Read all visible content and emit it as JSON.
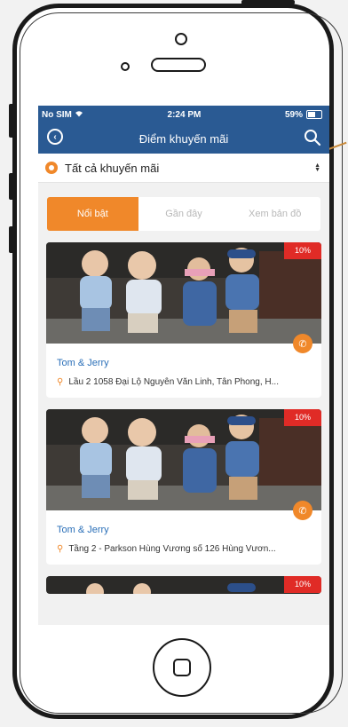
{
  "status_bar": {
    "carrier": "No SIM",
    "time": "2:24 PM",
    "battery": "59%"
  },
  "nav": {
    "title": "Điểm khuyến mãi"
  },
  "filter": {
    "label": "Tất cả khuyến mãi"
  },
  "tabs": [
    {
      "label": "Nổi bật",
      "active": true
    },
    {
      "label": "Gần đây",
      "active": false
    },
    {
      "label": "Xem bản đồ",
      "active": false
    }
  ],
  "promotions": [
    {
      "discount": "10%",
      "shop_name": "Tom & Jerry",
      "address": "Lầu 2 1058 Đại Lộ Nguyễn Văn Linh, Tân Phong, H..."
    },
    {
      "discount": "10%",
      "shop_name": "Tom & Jerry",
      "address": "Tầng 2 - Parkson Hùng Vương số 126 Hùng Vươn..."
    },
    {
      "discount": "10%"
    }
  ],
  "colors": {
    "primary": "#2a5a93",
    "accent": "#f0882a",
    "badge": "#e02b26",
    "link": "#2a6fb8"
  }
}
